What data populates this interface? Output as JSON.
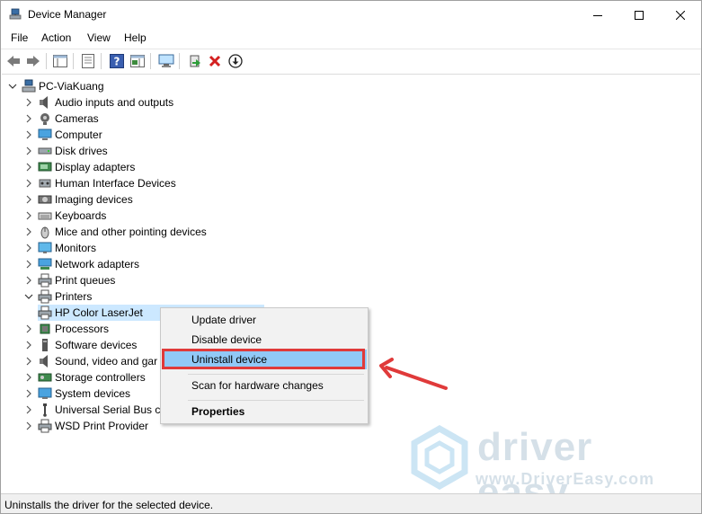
{
  "window": {
    "title": "Device Manager"
  },
  "menu": [
    "File",
    "Action",
    "View",
    "Help"
  ],
  "tree": {
    "root": "PC-ViaKuang",
    "categories": [
      {
        "label": "Audio inputs and outputs",
        "icon": "speaker-icon"
      },
      {
        "label": "Cameras",
        "icon": "camera-icon"
      },
      {
        "label": "Computer",
        "icon": "computer-icon"
      },
      {
        "label": "Disk drives",
        "icon": "disk-drive-icon"
      },
      {
        "label": "Display adapters",
        "icon": "display-adapter-icon"
      },
      {
        "label": "Human Interface Devices",
        "icon": "hid-icon"
      },
      {
        "label": "Imaging devices",
        "icon": "imaging-icon"
      },
      {
        "label": "Keyboards",
        "icon": "keyboard-icon"
      },
      {
        "label": "Mice and other pointing devices",
        "icon": "mouse-icon"
      },
      {
        "label": "Monitors",
        "icon": "monitor-icon"
      },
      {
        "label": "Network adapters",
        "icon": "network-adapter-icon"
      },
      {
        "label": "Print queues",
        "icon": "printer-icon"
      },
      {
        "label": "Printers",
        "icon": "printer-icon"
      },
      {
        "label": "HP Color LaserJet",
        "icon": "printer-icon"
      },
      {
        "label": "Processors",
        "icon": "processor-icon"
      },
      {
        "label": "Software devices",
        "icon": "software-device-icon"
      },
      {
        "label": "Sound, video and gar",
        "icon": "speaker-icon"
      },
      {
        "label": "Storage controllers",
        "icon": "storage-controller-icon"
      },
      {
        "label": "System devices",
        "icon": "system-device-icon"
      },
      {
        "label": "Universal Serial Bus co",
        "icon": "usb-icon"
      },
      {
        "label": "WSD Print Provider",
        "icon": "printer-icon"
      }
    ]
  },
  "context_menu": {
    "items": [
      "Update driver",
      "Disable device",
      "Uninstall device",
      "Scan for hardware changes",
      "Properties"
    ],
    "highlighted": "Uninstall device"
  },
  "watermark": {
    "brand": "driver easy",
    "url": "www.DriverEasy.com"
  },
  "status": {
    "text": "Uninstalls the driver for the selected device."
  },
  "colors": {
    "selection": "#cce8ff",
    "menu_highlight": "#91c9f7",
    "annotation_red": "#e03a3a"
  }
}
